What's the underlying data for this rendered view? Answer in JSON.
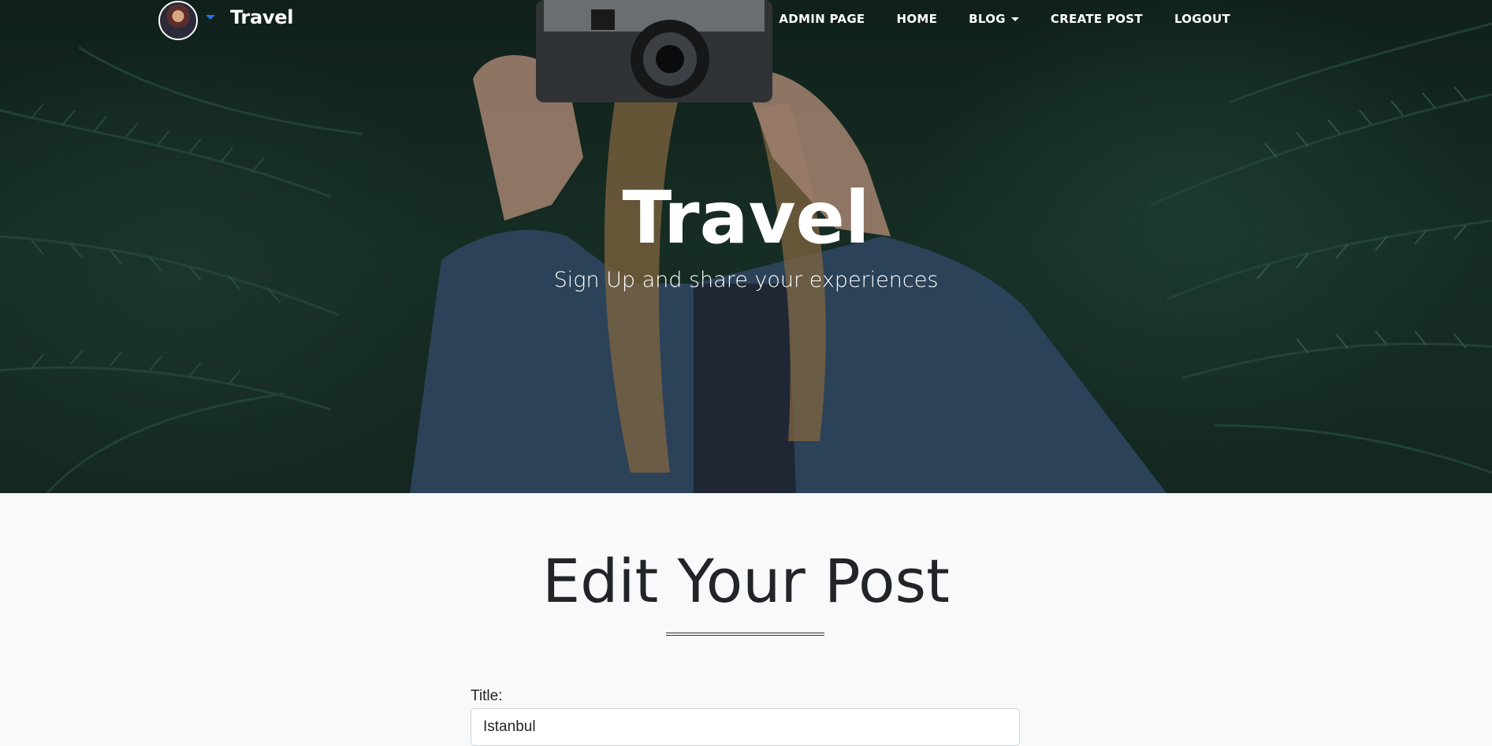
{
  "navbar": {
    "brand": "Travel",
    "links": [
      {
        "label": "ADMIN PAGE"
      },
      {
        "label": "HOME"
      },
      {
        "label": "BLOG",
        "dropdown": true
      },
      {
        "label": "CREATE POST"
      },
      {
        "label": "LOGOUT"
      }
    ]
  },
  "hero": {
    "title": "Travel",
    "subtitle": "Sign Up and share your experiences"
  },
  "main": {
    "page_title": "Edit Your Post",
    "title_label": "Title:",
    "title_value": "Istanbul"
  },
  "icons": {
    "avatar": "user-avatar",
    "avatar_caret": "caret-down-icon",
    "blog_caret": "caret-down-icon"
  },
  "colors": {
    "accent": "#1e73e8",
    "page_background": "#f8f9fa",
    "text": "#212529"
  }
}
